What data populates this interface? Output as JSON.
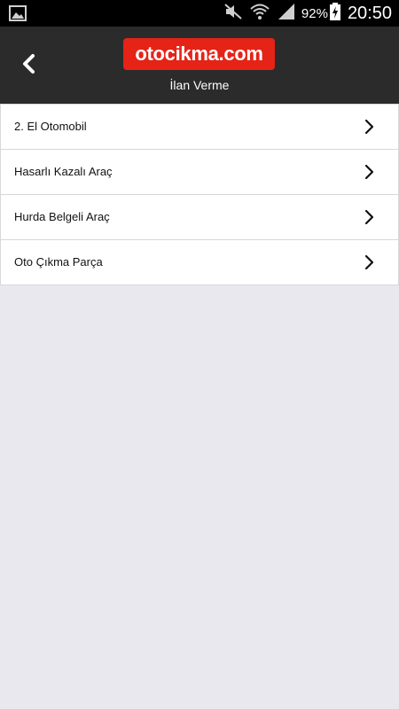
{
  "status_bar": {
    "battery": "92%",
    "time": "20:50"
  },
  "header": {
    "logo_text": "otocikma.com",
    "subtitle": "İlan Verme"
  },
  "list": {
    "items": [
      {
        "label": "2. El Otomobil"
      },
      {
        "label": "Hasarlı Kazalı Araç"
      },
      {
        "label": "Hurda Belgeli Araç"
      },
      {
        "label": "Oto Çıkma Parça"
      }
    ]
  },
  "colors": {
    "header_bg": "#2b2b2b",
    "logo_bg": "#e52317",
    "page_bg": "#e8e8ee"
  },
  "icons": {
    "back": "chevron-left-icon",
    "item_arrow": "chevron-right-icon",
    "gallery": "gallery-icon",
    "mute": "mute-icon",
    "wifi": "wifi-icon",
    "signal": "signal-icon",
    "battery": "battery-charging-icon"
  }
}
